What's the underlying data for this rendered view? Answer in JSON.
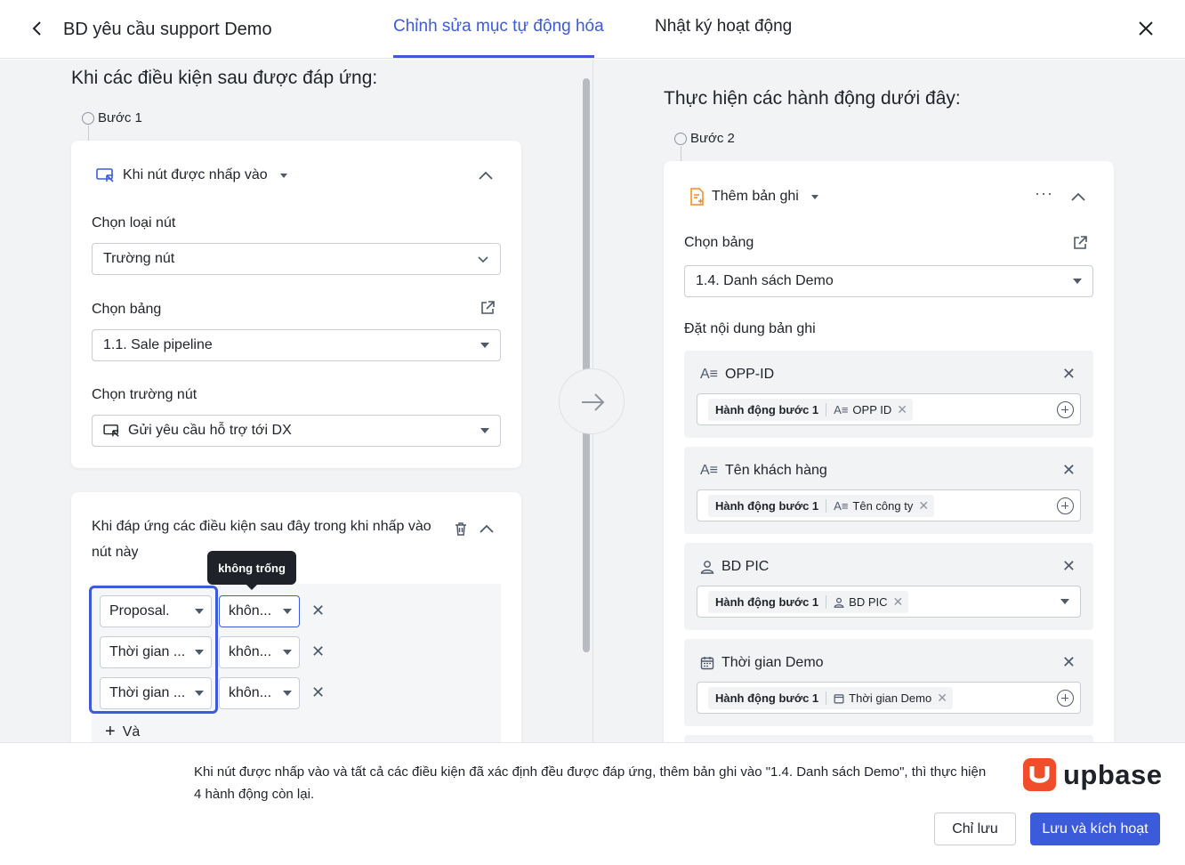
{
  "header": {
    "title": "BD yêu cầu support Demo",
    "tabs": [
      {
        "label": "Chỉnh sửa mục tự động hóa",
        "active": true
      },
      {
        "label": "Nhật ký hoạt động",
        "active": false
      }
    ]
  },
  "left": {
    "section_title": "Khi các điều kiện sau được đáp ứng:",
    "step_label": "Bước 1",
    "trigger": {
      "title": "Khi nút được nhấp vào",
      "button_type_label": "Chọn loại nút",
      "button_type_value": "Trường nút",
      "table_label": "Chọn bảng",
      "table_value": "1.1. Sale pipeline",
      "field_label": "Chọn trường nút",
      "field_value": "Gửi yêu cầu hỗ trợ tới DX"
    },
    "conditions": {
      "title": "Khi đáp ứng các điều kiện sau đây trong khi nhấp vào nút này",
      "rows": [
        {
          "field": "Proposal.",
          "operator": "khôn..."
        },
        {
          "field": "Thời gian ...",
          "operator": "khôn..."
        },
        {
          "field": "Thời gian ...",
          "operator": "khôn..."
        }
      ],
      "tooltip": "không trống",
      "add_label": "Và"
    }
  },
  "right": {
    "section_title": "Thực hiện các hành động dưới đây:",
    "step_label": "Bước 2",
    "action": {
      "title": "Thêm bản ghi",
      "table_label": "Chọn bảng",
      "table_value": "1.4. Danh sách Demo",
      "content_label": "Đặt nội dung bản ghi",
      "fields": [
        {
          "name": "OPP-ID",
          "icon": "text-field-icon",
          "chip_source": "Hành động bước 1",
          "chip_value": "OPP ID",
          "chip_icon": "text-field-icon",
          "control": "plus"
        },
        {
          "name": "Tên khách hàng",
          "icon": "text-field-icon",
          "chip_source": "Hành động bước 1",
          "chip_value": "Tên công ty",
          "chip_icon": "text-field-icon",
          "control": "plus"
        },
        {
          "name": "BD PIC",
          "icon": "person-icon",
          "chip_source": "Hành động bước 1",
          "chip_value": "BD PIC",
          "chip_icon": "person-icon",
          "control": "dropdown"
        },
        {
          "name": "Thời gian Demo",
          "icon": "calendar-icon",
          "chip_source": "Hành động bước 1",
          "chip_value": "Thời gian Demo",
          "chip_icon": "calendar-icon",
          "control": "plus"
        }
      ]
    }
  },
  "footer": {
    "summary": "Khi nút được nhấp vào và tất cả các điều kiện đã xác định đều được đáp ứng, thêm bản ghi vào \"1.4. Danh sách Demo\", thì thực hiện 4 hành động còn lại.",
    "logo_text": "upbase",
    "save_label": "Chỉ lưu",
    "save_activate_label": "Lưu và kích hoạt"
  },
  "colors": {
    "accent": "#3b5bdb",
    "brand": "#f04e2a",
    "background": "#f2f3f5"
  }
}
